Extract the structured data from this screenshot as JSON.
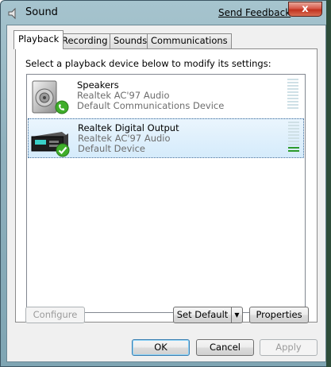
{
  "window": {
    "title": "Sound",
    "feedback_link": "Send Feedback",
    "close_glyph": "x"
  },
  "tabs": [
    {
      "label": "Playback",
      "active": true
    },
    {
      "label": "Recording",
      "active": false
    },
    {
      "label": "Sounds",
      "active": false
    },
    {
      "label": "Communications",
      "active": false
    }
  ],
  "panel": {
    "instruction": "Select a playback device below to modify its settings:"
  },
  "devices": [
    {
      "name": "Speakers",
      "driver": "Realtek AC'97 Audio",
      "status": "Default Communications Device",
      "icon": "speaker-icon",
      "badge_icon": "phone-icon",
      "selected": false,
      "level_segments_lit": 0
    },
    {
      "name": "Realtek Digital Output",
      "driver": "Realtek AC'97 Audio",
      "status": "Default Device",
      "icon": "digital-output-icon",
      "badge_icon": "checkmark-icon",
      "selected": true,
      "level_segments_lit": 2
    }
  ],
  "buttons": {
    "configure": "Configure",
    "set_default": "Set Default",
    "properties": "Properties",
    "ok": "OK",
    "cancel": "Cancel",
    "apply": "Apply"
  },
  "colors": {
    "selection": "#d5ebfb",
    "meter_on": "#2b9a2b",
    "meter_off": "#cfe0e6",
    "badge_green": "#3fae2a"
  }
}
